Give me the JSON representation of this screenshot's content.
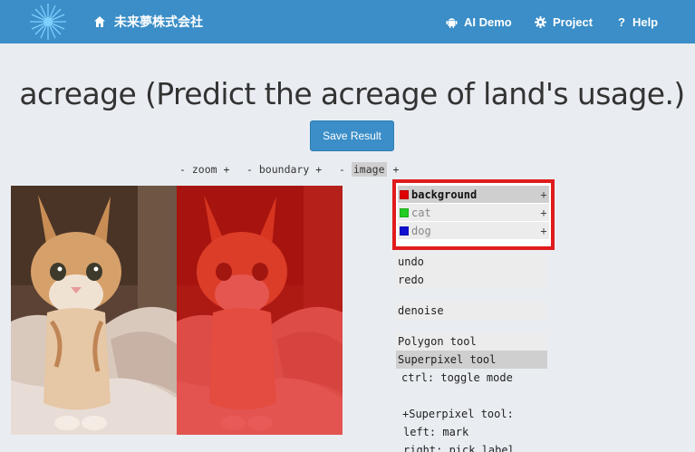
{
  "navbar": {
    "brand": "未来夢株式会社",
    "items": [
      {
        "label": "AI Demo",
        "icon": "android-icon"
      },
      {
        "label": "Project",
        "icon": "gear-icon"
      },
      {
        "label": "Help",
        "icon": "question-icon"
      }
    ],
    "color": "#3b8ec7"
  },
  "title": "acreage (Predict the acreage of land's usage.)",
  "save_button": "Save Result",
  "toolbar": {
    "zoom": {
      "minus": "-",
      "label": "zoom",
      "plus": "+"
    },
    "boundary": {
      "minus": "-",
      "label": "boundary",
      "plus": "+"
    },
    "image": {
      "minus": "-",
      "label": "image",
      "plus": "+"
    }
  },
  "legend": [
    {
      "label": "background",
      "color": "#e00000",
      "plus": "+",
      "selected": true
    },
    {
      "label": "cat",
      "color": "#22cc22",
      "plus": "+",
      "selected": false
    },
    {
      "label": "dog",
      "color": "#1010d0",
      "plus": "+",
      "selected": false
    }
  ],
  "menu": {
    "undo": "undo",
    "redo": "redo",
    "denoise": "denoise",
    "polygon_tool": "Polygon tool",
    "superpixel_tool": "Superpixel tool",
    "toggle_hint": "ctrl: toggle mode",
    "sp_heading": "+Superpixel tool:",
    "left_hint": "left: mark",
    "right_hint": "right: pick label"
  },
  "images": {
    "original": "kitten photo",
    "annotated": "kitten photo with red background mask"
  }
}
